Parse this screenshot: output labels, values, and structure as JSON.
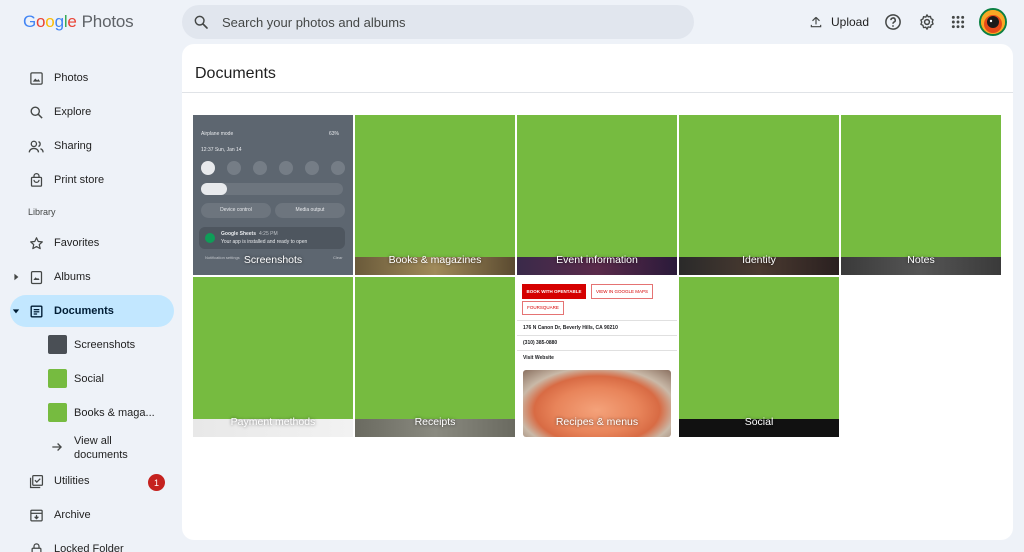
{
  "header": {
    "logo_google": [
      "G",
      "o",
      "o",
      "g",
      "l",
      "e"
    ],
    "logo_product": "Photos",
    "search_placeholder": "Search your photos and albums",
    "upload_label": "Upload"
  },
  "sidebar": {
    "items": [
      {
        "label": "Photos",
        "icon": "photo-icon"
      },
      {
        "label": "Explore",
        "icon": "search-icon"
      },
      {
        "label": "Sharing",
        "icon": "people-icon"
      },
      {
        "label": "Print store",
        "icon": "shopping-bag-icon"
      }
    ],
    "library_header": "Library",
    "library_items": [
      {
        "label": "Favorites",
        "icon": "star-icon"
      },
      {
        "label": "Albums",
        "icon": "album-icon"
      },
      {
        "label": "Documents",
        "icon": "document-icon",
        "active": true
      }
    ],
    "documents_children": [
      {
        "label": "Screenshots"
      },
      {
        "label": "Social"
      },
      {
        "label": "Books & maga..."
      }
    ],
    "view_all_label": "View all documents",
    "more_items": [
      {
        "label": "Utilities",
        "icon": "utilities-icon",
        "badge": "1"
      },
      {
        "label": "Archive",
        "icon": "archive-icon"
      },
      {
        "label": "Locked Folder",
        "icon": "lock-icon"
      }
    ]
  },
  "main": {
    "title": "Documents",
    "tiles": [
      {
        "label": "Screenshots"
      },
      {
        "label": "Books & magazines"
      },
      {
        "label": "Event information"
      },
      {
        "label": "Identity"
      },
      {
        "label": "Notes"
      },
      {
        "label": "Payment methods"
      },
      {
        "label": "Receipts"
      },
      {
        "label": "Recipes & menus"
      },
      {
        "label": "Social"
      }
    ]
  },
  "screenshot_thumb": {
    "status": "Airplane mode",
    "battery": "63%",
    "time_date": "12:37  Sun, Jan 14",
    "device_control": "Device control",
    "media_output": "Media output",
    "notif_title": "Google Sheets",
    "notif_time": "4:25 PM",
    "notif_body": "Your app is installed and ready to open",
    "notif_settings": "Notification settings",
    "clear": "Clear"
  },
  "recipe_thumb": {
    "book_button": "BOOK WITH OPENTABLE",
    "maps_button": "VIEW IN GOOGLE MAPS",
    "foursquare_button": "FOURSQUARE",
    "address": "176 N Canon Dr, Beverly Hills, CA 90210",
    "phone": "(310) 385-0880",
    "website": "Visit Website"
  },
  "colors": {
    "accent_active_bg": "#c2e7ff",
    "green_tile": "#76bb40",
    "badge_red": "#c5221f"
  }
}
